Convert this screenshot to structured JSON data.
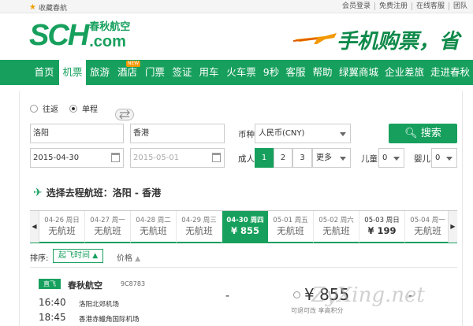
{
  "topbar": {
    "favorite_label": "收藏春航",
    "links": [
      "会员登录",
      "免费注册",
      "在线客服",
      "团队"
    ]
  },
  "logo": {
    "mark": "SCH",
    "cn": "春秋航空",
    "com": ".com"
  },
  "banner": {
    "slogan": "手机购票，省"
  },
  "nav": {
    "items": [
      "首页",
      "机票",
      "旅游",
      "酒店",
      "门票",
      "签证",
      "用车",
      "火车票",
      "9秒",
      "客服",
      "帮助",
      "绿翼商城",
      "企业差旅",
      "走进春秋"
    ],
    "active": "机票",
    "new_badge": "NEW"
  },
  "search": {
    "round_trip_label": "往返",
    "one_way_label": "单程",
    "from_city": "洛阳",
    "to_city": "香港",
    "depart_date": "2015-04-30",
    "return_date": "2015-05-01",
    "currency_label": "币种",
    "currency_value": "人民币(CNY)",
    "adult_label": "成人",
    "adult_options": [
      "1",
      "2",
      "3",
      "更多"
    ],
    "adult_selected": "1",
    "child_label": "儿童",
    "child_value": "0",
    "infant_label": "婴儿",
    "infant_value": "0",
    "search_button": "搜索"
  },
  "results": {
    "title": "选择去程航班：洛阳 - 香港",
    "days": [
      {
        "date": "04-26 周日",
        "price": "无航班"
      },
      {
        "date": "04-27 周一",
        "price": "无航班"
      },
      {
        "date": "04-28 周二",
        "price": "无航班"
      },
      {
        "date": "04-29 周三",
        "price": "无航班"
      },
      {
        "date": "04-30 周四",
        "price": "¥ 855"
      },
      {
        "date": "05-01 周五",
        "price": "无航班"
      },
      {
        "date": "05-02 周六",
        "price": "无航班"
      },
      {
        "date": "05-03 周日",
        "price": "¥ 199"
      },
      {
        "date": "05-04 周一",
        "price": "无航班"
      }
    ],
    "selected_index": 4,
    "sort_label": "排序:",
    "sort_time": "起飞时间",
    "sort_price": "价格"
  },
  "flight": {
    "tag": "直飞",
    "airline": "春秋航空",
    "number": "9C8783",
    "dep_time": "16:40",
    "dep_airport": "洛阳北郊机场",
    "arr_time": "18:45",
    "arr_airport": "香港赤鱲角国际机场",
    "dash1": "-",
    "price": "¥ 855",
    "note": "可退可改 享高积分",
    "dash2": "-"
  },
  "watermark": "ZyXing.net"
}
